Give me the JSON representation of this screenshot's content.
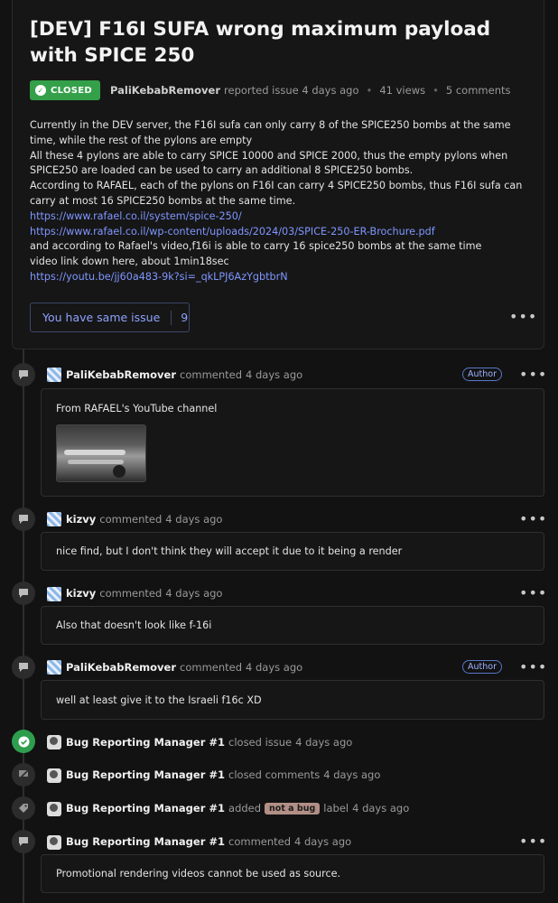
{
  "issue": {
    "title": "[DEV] F16I SUFA wrong maximum payload with SPICE 250",
    "status": "CLOSED",
    "author": "PaliKebabRemover",
    "reported_text": "reported issue 4 days ago",
    "views": "41 views",
    "comments_count": "5 comments",
    "body": {
      "p1": "Currently in the DEV server, the F16I sufa can only carry 8 of the SPICE250 bombs at the same time, while the rest of the pylons are empty",
      "p2": "All these 4 pylons are able to carry SPICE 10000 and SPICE 2000, thus the empty pylons when SPICE250 are loaded can be used to carry an additional 8 SPICE250 bombs.",
      "p3": "According to RAFAEL, each of the pylons on F16I can carry 4 SPICE250 bombs, thus F16I sufa can carry at most 16 SPICE250 bombs at the same time.",
      "link1": "https://www.rafael.co.il/system/spice-250/",
      "link2": "https://www.rafael.co.il/wp-content/uploads/2024/03/SPICE-250-ER-Brochure.pdf",
      "p4": "and according to Rafael's video,f16i is able to carry 16 spice250 bombs at the same time",
      "p5": "video link down here, about 1min18sec",
      "link3": "https://youtu.be/jj60a483-9k?si=_qkLPJ6AzYgbtbrN"
    },
    "same_issue_label": "You have same issue",
    "same_issue_count": "9"
  },
  "timeline": {
    "c1": {
      "author": "PaliKebabRemover",
      "action": "commented",
      "time": "4 days ago",
      "badge": "Author",
      "text": "From RAFAEL's YouTube channel"
    },
    "c2": {
      "author": "kizvy",
      "action": "commented",
      "time": "4 days ago",
      "text": "nice find, but I don't think they will accept it due to it being a render"
    },
    "c3": {
      "author": "kizvy",
      "action": "commented",
      "time": "4 days ago",
      "text": "Also that doesn't look like f-16i"
    },
    "c4": {
      "author": "PaliKebabRemover",
      "action": "commented",
      "time": "4 days ago",
      "badge": "Author",
      "text": "well at least give it to the Israeli f16c XD"
    },
    "e1": {
      "author": "Bug Reporting Manager #1",
      "action": "closed issue",
      "time": "4 days ago"
    },
    "e2": {
      "author": "Bug Reporting Manager #1",
      "action": "closed comments",
      "time": "4 days ago"
    },
    "e3": {
      "author": "Bug Reporting Manager #1",
      "action": "added",
      "label": "not a bug",
      "action2": "label",
      "time": "4 days ago"
    },
    "c5": {
      "author": "Bug Reporting Manager #1",
      "action": "commented",
      "time": "4 days ago",
      "text": "Promotional rendering videos cannot be used as source."
    }
  },
  "icons": {
    "closed": "check-circle-icon",
    "comment": "comment-icon",
    "lock": "comments-closed-icon",
    "label": "tag-icon",
    "more": "more-dots-icon"
  },
  "colors": {
    "closed_green": "#35a04a",
    "link": "#7f96ff",
    "label_notbug": "#b28f86"
  }
}
